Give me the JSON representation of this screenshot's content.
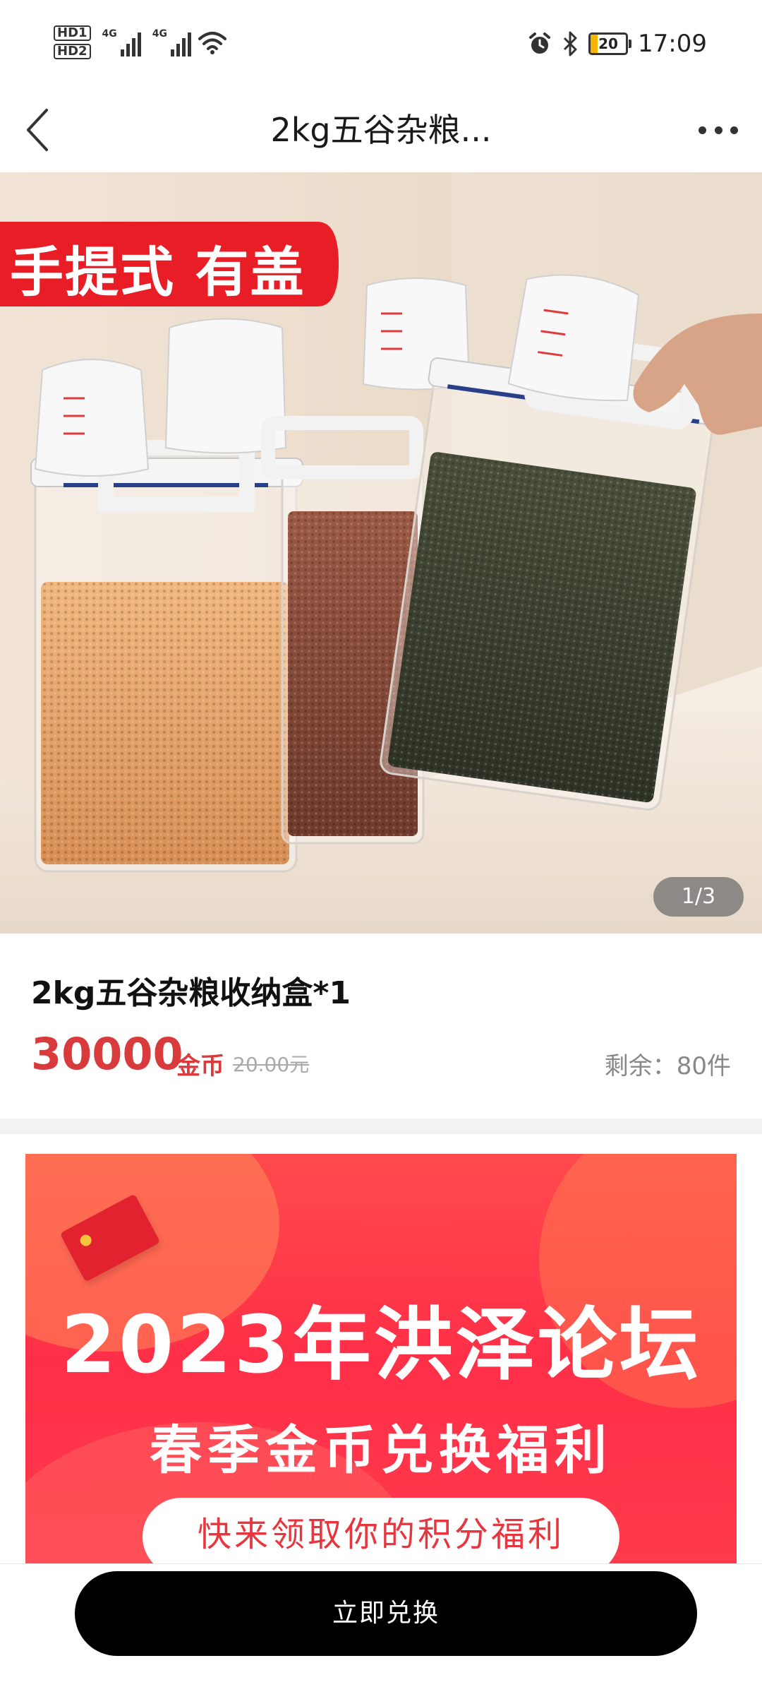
{
  "status_bar": {
    "sim1": "HD1",
    "sim2": "HD2",
    "net1": "4G",
    "net2": "4G",
    "battery": "20",
    "time": "17:09",
    "icons": [
      "alarm-icon",
      "bluetooth-icon",
      "wifi-icon",
      "signal-icon",
      "battery-icon"
    ]
  },
  "nav": {
    "title": "2kg五谷杂粮...",
    "back_icon": "chevron-left-icon",
    "more_icon": "more-dots-icon"
  },
  "hero": {
    "badge": "手提式 有盖",
    "pager": "1/3"
  },
  "product": {
    "title": "2kg五谷杂粮收纳盒*1",
    "price": "30000",
    "price_unit": "金币",
    "original_price": "20.00元",
    "stock": "剩余：80件"
  },
  "banner": {
    "title": "2023年洪泽论坛",
    "subtitle": "春季金币兑换福利",
    "pill": "快来领取你的积分福利"
  },
  "cta": {
    "label": "立即兑换"
  },
  "colors": {
    "price_red": "#d93a3c",
    "banner_red": "#ff2f47",
    "cta_black": "#000000"
  }
}
